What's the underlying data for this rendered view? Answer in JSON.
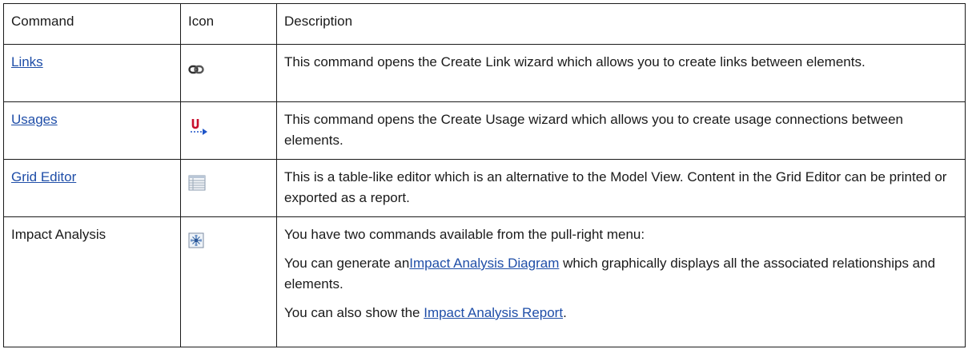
{
  "table": {
    "headers": {
      "command": "Command",
      "icon": "Icon",
      "description": "Description"
    },
    "rows": [
      {
        "command": "Links",
        "command_is_link": true,
        "icon": "chain-link-icon",
        "description": "This command opens the Create Link wizard which allows you to create links between elements."
      },
      {
        "command": "Usages",
        "command_is_link": true,
        "icon": "usage-arrow-icon",
        "description": "This command opens the Create Usage wizard which allows you to create usage connections between elements."
      },
      {
        "command": "Grid Editor",
        "command_is_link": true,
        "icon": "grid-table-icon",
        "description": "This is a table-like editor which is an alternative to the Model View. Content in the Grid Editor can be printed or exported as a report."
      },
      {
        "command": "Impact Analysis",
        "command_is_link": false,
        "icon": "impact-analysis-icon",
        "paragraphs": {
          "p1": "You have two commands available from the pull-right menu:",
          "p2_prefix": "You can generate an",
          "p2_link": "Impact Analysis Diagram",
          "p2_suffix": " which graphically displays all the associated relationships and elements.",
          "p3_prefix": "You can also show the ",
          "p3_link": "Impact Analysis Report",
          "p3_suffix": "."
        }
      }
    ]
  },
  "colors": {
    "border": "#1a1a1a",
    "link": "#1f4ea8",
    "usage_icon_red": "#c8102e",
    "usage_icon_blue": "#1f55c8"
  }
}
